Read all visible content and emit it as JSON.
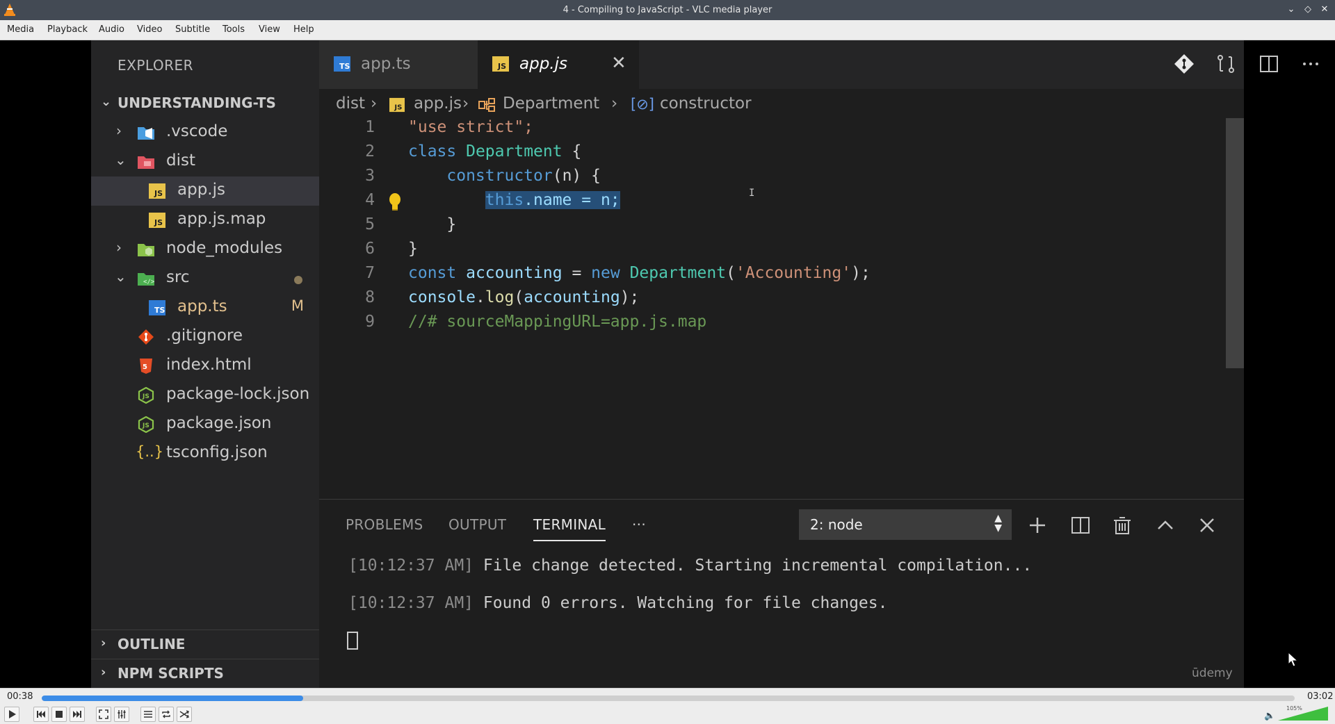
{
  "window": {
    "title": "4 - Compiling to JavaScript - VLC media player"
  },
  "menubar": {
    "items": [
      "Media",
      "Playback",
      "Audio",
      "Video",
      "Subtitle",
      "Tools",
      "View",
      "Help"
    ]
  },
  "vscode": {
    "explorer_title": "EXPLORER",
    "project": "UNDERSTANDING-TS",
    "tree": [
      {
        "label": ".vscode",
        "type": "folder",
        "expanded": false
      },
      {
        "label": "dist",
        "type": "folder",
        "expanded": true
      },
      {
        "label": "app.js",
        "type": "js-file",
        "selected": true
      },
      {
        "label": "app.js.map",
        "type": "js-file"
      },
      {
        "label": "node_modules",
        "type": "folder",
        "expanded": false
      },
      {
        "label": "src",
        "type": "folder",
        "expanded": true
      },
      {
        "label": "app.ts",
        "type": "ts-file",
        "badge": "M"
      },
      {
        "label": ".gitignore",
        "type": "git-file"
      },
      {
        "label": "index.html",
        "type": "html-file"
      },
      {
        "label": "package-lock.json",
        "type": "json-file"
      },
      {
        "label": "package.json",
        "type": "json-file"
      },
      {
        "label": "tsconfig.json",
        "type": "json-config-file"
      }
    ],
    "outline": "OUTLINE",
    "npm_scripts": "NPM SCRIPTS",
    "tabs": [
      {
        "label": "app.ts",
        "active": false
      },
      {
        "label": "app.js",
        "active": true
      }
    ],
    "breadcrumb": [
      "dist",
      "app.js",
      "Department",
      "constructor"
    ],
    "code_lines": [
      "1",
      "2",
      "3",
      "4",
      "5",
      "6",
      "7",
      "8",
      "9"
    ],
    "code": {
      "l1": "\"use strict\";",
      "l2_kw": "class",
      "l2_cls": "Department",
      "l2_end": "{",
      "l3_fn": "constructor",
      "l3_rest": "(n) {",
      "l4_this": "this",
      "l4_rest": ".name = n;",
      "l5": "}",
      "l6": "}",
      "l7_kw": "const",
      "l7_var": "accounting",
      "l7_eq": "=",
      "l7_new": "new",
      "l7_cls": "Department",
      "l7_str": "'Accounting'",
      "l7_end": ");",
      "l8_obj": "console",
      "l8_fn": "log",
      "l8_arg": "accounting",
      "l8_end": ");",
      "l9": "//# sourceMappingURL=app.js.map"
    },
    "panel": {
      "tabs": [
        "PROBLEMS",
        "OUTPUT",
        "TERMINAL"
      ],
      "more": "···",
      "terminal_select": "2: node",
      "lines": [
        {
          "ts": "[10:12:37 AM]",
          "msg": "File change detected. Starting incremental compilation..."
        },
        {
          "ts": "[10:12:37 AM]",
          "msg": "Found 0 errors. Watching for file changes."
        }
      ],
      "watermark": "ūdemy"
    }
  },
  "player": {
    "elapsed": "00:38",
    "total": "03:02",
    "progress": 0.2088,
    "volume": "105%"
  },
  "colors": {
    "accent": "#3c8ce7",
    "js_icon": "#e8c34a",
    "ts_icon": "#2f7bd5",
    "modified": "#e2c08d"
  }
}
